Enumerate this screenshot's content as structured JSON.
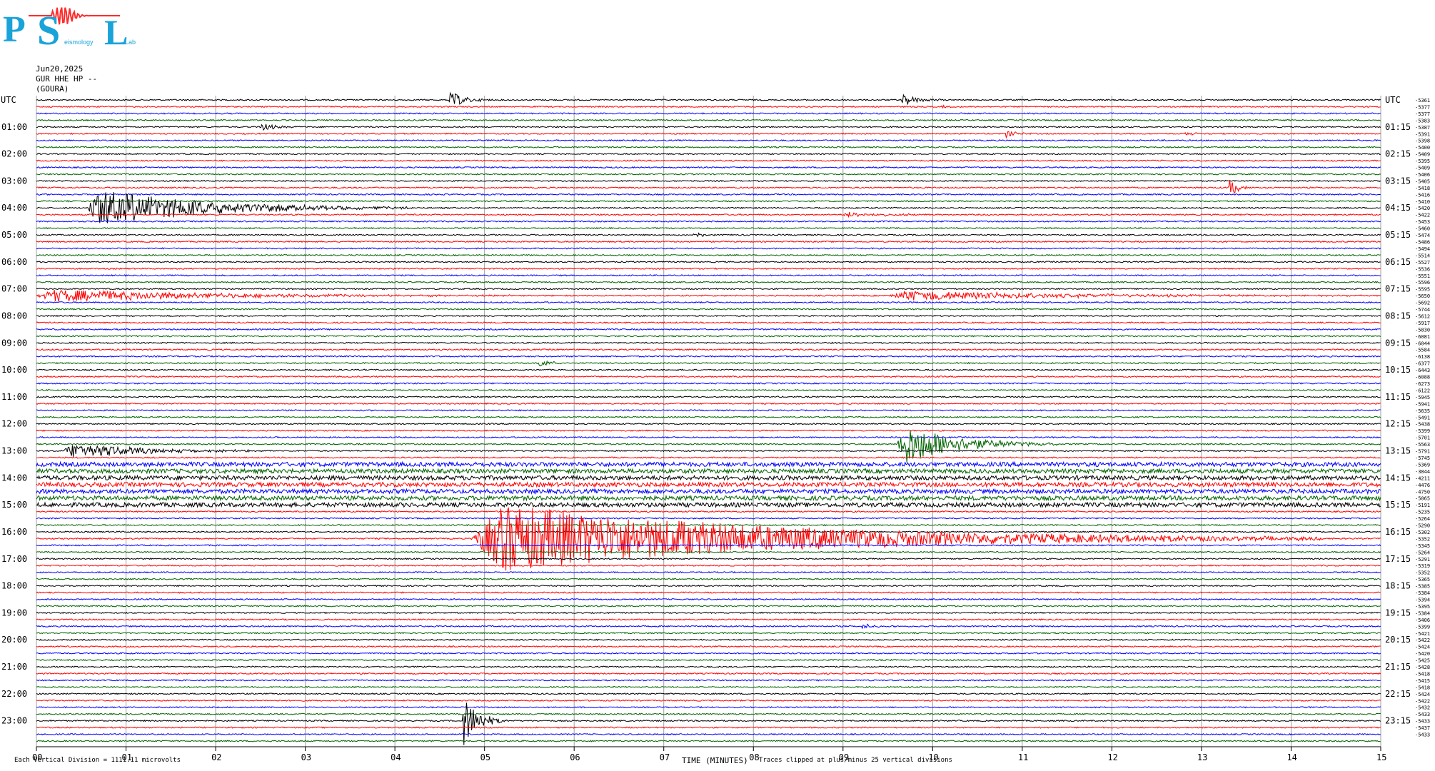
{
  "header": {
    "date": "Jun20,2025",
    "channel": "GUR HHE HP --",
    "station": "(GOURA)"
  },
  "logo": {
    "letters": [
      "P",
      "S",
      "L"
    ],
    "text_lab": "Lab",
    "text_seismology": "eismology"
  },
  "footer": {
    "division_note": "Each Vertical Division = 1111.11 microvolts",
    "x_axis_label": "TIME (MINUTES)",
    "clip_note": "Traces clipped at plus/minus 25 vertical divisions"
  },
  "colors": {
    "traces": [
      "#000000",
      "#ff0000",
      "#0000ff",
      "#006400"
    ],
    "logo_blue": "#1aa3d9",
    "logo_red": "#ff2a2a",
    "grid": "#a0a0a0"
  },
  "chart_data": {
    "type": "line",
    "title": "",
    "xlabel": "TIME (MINUTES)",
    "ylabel": "",
    "xlim": [
      0,
      15
    ],
    "x_ticks": [
      "00",
      "01",
      "02",
      "03",
      "04",
      "05",
      "06",
      "07",
      "08",
      "09",
      "10",
      "11",
      "12",
      "13",
      "14",
      "15"
    ],
    "left_labels": [
      "UTC",
      "01:00",
      "02:00",
      "03:00",
      "04:00",
      "05:00",
      "06:00",
      "07:00",
      "08:00",
      "09:00",
      "10:00",
      "11:00",
      "12:00",
      "13:00",
      "14:00",
      "15:00",
      "16:00",
      "17:00",
      "18:00",
      "19:00",
      "20:00",
      "21:00",
      "22:00",
      "23:00"
    ],
    "right_labels": [
      "UTC",
      "01:15",
      "02:15",
      "03:15",
      "04:15",
      "05:15",
      "06:15",
      "07:15",
      "08:15",
      "09:15",
      "10:15",
      "11:15",
      "12:15",
      "13:15",
      "14:15",
      "15:15",
      "16:15",
      "17:15",
      "18:15",
      "19:15",
      "20:15",
      "21:15",
      "22:15",
      "23:15"
    ],
    "trace_offsets": [
      "-5361",
      "-5377",
      "-5377",
      "-5383",
      "-5387",
      "-5391",
      "-5398",
      "-5400",
      "-5409",
      "-5395",
      "-5409",
      "-5406",
      "-5405",
      "-5418",
      "-5416",
      "-5410",
      "-5420",
      "-5422",
      "-5453",
      "-5460",
      "-5474",
      "-5486",
      "-5494",
      "-5514",
      "-5527",
      "-5536",
      "-5551",
      "-5596",
      "-5595",
      "-5650",
      "-5692",
      "-5744",
      "-5612",
      "-5917",
      "-5830",
      "-6081",
      "-6044",
      "-5584",
      "-6138",
      "-6377",
      "-6443",
      "-6088",
      "-6273",
      "-6122",
      "-5945",
      "-5941",
      "-5635",
      "-5491",
      "-5438",
      "-5399",
      "-5701",
      "-5563",
      "-5791",
      "-5745",
      "-5369",
      "-3844",
      "-4211",
      "-4476",
      "-4750",
      "-5065",
      "-5191",
      "-5235",
      "-5264",
      "-5290",
      "-5302",
      "-5352",
      "-5345",
      "-5264",
      "-5291",
      "-5319",
      "-5352",
      "-5365",
      "-5385",
      "-5384",
      "-5394",
      "-5395",
      "-5384",
      "-5406",
      "-5399",
      "-5421",
      "-5422",
      "-5424",
      "-5420",
      "-5425",
      "-5428",
      "-5418",
      "-5415",
      "-5418",
      "-5424",
      "-5422",
      "-5432",
      "-5433",
      "-5433",
      "-5437",
      "-5433"
    ],
    "trace_count": 96,
    "traces_per_hour": 4,
    "minutes_per_trace": 15,
    "events": [
      {
        "trace": 0,
        "minute": 4.6,
        "duration": 0.5,
        "amplitude": 14
      },
      {
        "trace": 0,
        "minute": 9.65,
        "duration": 0.5,
        "amplitude": 10
      },
      {
        "trace": 1,
        "minute": 10.1,
        "duration": 0.2,
        "amplitude": 2
      },
      {
        "trace": 4,
        "minute": 2.5,
        "duration": 0.4,
        "amplitude": 7
      },
      {
        "trace": 5,
        "minute": 10.8,
        "duration": 0.35,
        "amplitude": 6
      },
      {
        "trace": 5,
        "minute": 12.8,
        "duration": 0.3,
        "amplitude": 4
      },
      {
        "trace": 13,
        "minute": 13.3,
        "duration": 0.25,
        "amplitude": 18
      },
      {
        "trace": 16,
        "minute": 0.55,
        "duration": 3.6,
        "amplitude": 30
      },
      {
        "trace": 17,
        "minute": 9.0,
        "duration": 1.4,
        "amplitude": 4
      },
      {
        "trace": 20,
        "minute": 7.3,
        "duration": 0.4,
        "amplitude": 5
      },
      {
        "trace": 29,
        "minute": 0.0,
        "duration": 5.3,
        "amplitude": 10
      },
      {
        "trace": 29,
        "minute": 9.5,
        "duration": 5.3,
        "amplitude": 8
      },
      {
        "trace": 39,
        "minute": 5.6,
        "duration": 0.35,
        "amplitude": 8
      },
      {
        "trace": 51,
        "minute": 9.6,
        "duration": 1.8,
        "amplitude": 34
      },
      {
        "trace": 52,
        "minute": 0.3,
        "duration": 2.5,
        "amplitude": 12
      },
      {
        "trace": 65,
        "minute": 4.85,
        "duration": 9.5,
        "amplitude": 55
      },
      {
        "trace": 78,
        "minute": 9.2,
        "duration": 0.35,
        "amplitude": 5
      },
      {
        "trace": 92,
        "minute": 4.75,
        "duration": 0.5,
        "amplitude": 40
      }
    ],
    "noisy_traces": [
      54,
      55,
      56,
      57,
      58,
      59,
      60
    ]
  }
}
